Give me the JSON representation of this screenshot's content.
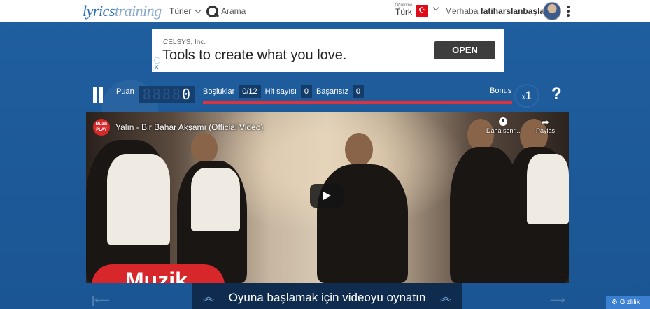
{
  "topbar": {
    "logo_part1": "lyrics",
    "logo_part2": "training",
    "genres_label": "Türler",
    "search_label": "Arama",
    "learning_small": "Öğrenme",
    "learning_lang": "Türk",
    "greeting_prefix": "Merhaba",
    "username": "fatiharslanbaşlar !"
  },
  "ad": {
    "company": "CELSYS, Inc.",
    "title": "Tools to create what you love.",
    "button": "OPEN"
  },
  "game": {
    "score_label": "Puan",
    "score_ghost": "8888",
    "score_value": "0",
    "gaps_label": "Boşluklar",
    "gaps_value": "0/12",
    "hits_label": "Hit sayısı",
    "hits_value": "0",
    "fails_label": "Başarısız",
    "fails_value": "0",
    "bonus_label": "Bonus",
    "bonus_prefix": "x",
    "bonus_value": "1",
    "help": "?"
  },
  "video": {
    "channel_badge": "Muzik PLAY",
    "title": "Yalın - Bir Bahar Akşamı (Official Video)",
    "watch_later": "Daha sonr...",
    "share": "Paylaş",
    "overlay_logo": "Muzik"
  },
  "bottom": {
    "start_message": "Oyuna başlamak için videoyu oynatın",
    "privacy": "Gizlilik"
  },
  "colors": {
    "background": "#1d5a9a",
    "progress": "#e0323c",
    "start_bar": "#0f2c4e"
  }
}
